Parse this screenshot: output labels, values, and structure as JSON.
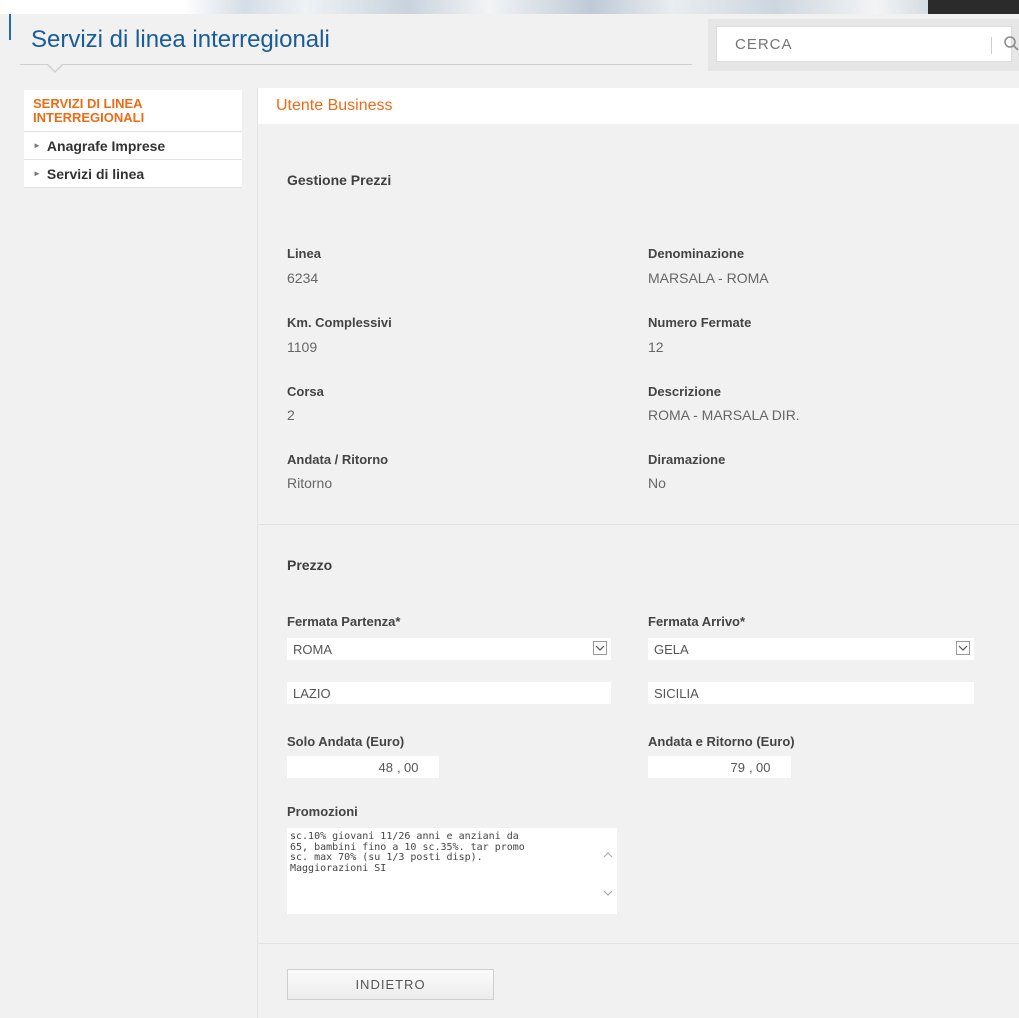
{
  "header": {
    "title": "Servizi di linea interregionali",
    "search_placeholder": "CERCA"
  },
  "sidebar": {
    "heading": "SERVIZI DI LINEA INTERREGIONALI",
    "items": [
      {
        "label": "Anagrafe Imprese"
      },
      {
        "label": "Servizi di linea"
      }
    ]
  },
  "main": {
    "tab_title": "Utente Business",
    "gestione": {
      "heading": "Gestione Prezzi",
      "fields": {
        "linea": {
          "label": "Linea",
          "value": "6234"
        },
        "denominazione": {
          "label": "Denominazione",
          "value": "MARSALA - ROMA"
        },
        "km": {
          "label": "Km. Complessivi",
          "value": "1109"
        },
        "fermate": {
          "label": "Numero Fermate",
          "value": "12"
        },
        "corsa": {
          "label": "Corsa",
          "value": "2"
        },
        "descrizione": {
          "label": "Descrizione",
          "value": "ROMA - MARSALA DIR."
        },
        "andata_ritorno": {
          "label": "Andata / Ritorno",
          "value": "Ritorno"
        },
        "diramazione": {
          "label": "Diramazione",
          "value": "No"
        }
      }
    },
    "prezzo": {
      "heading": "Prezzo",
      "partenza": {
        "label": "Fermata Partenza*",
        "value": "ROMA",
        "region": "LAZIO"
      },
      "arrivo": {
        "label": "Fermata Arrivo*",
        "value": "GELA",
        "region": "SICILIA"
      },
      "solo_andata": {
        "label": "Solo Andata (Euro)",
        "int": "48",
        "dec": "00"
      },
      "andata_ritorno": {
        "label": "Andata e Ritorno (Euro)",
        "int": "79",
        "dec": "00"
      },
      "promozioni": {
        "label": "Promozioni",
        "text": "sc.10% giovani 11/26 anni e anziani da\n65, bambini fino a 10 sc.35%. tar promo\nsc. max 70% (su 1/3 posti disp).\nMaggiorazioni SI"
      }
    },
    "back_label": "INDIETRO"
  },
  "colors": {
    "accent_orange": "#ee6b16",
    "title_blue": "#1a5c97"
  }
}
